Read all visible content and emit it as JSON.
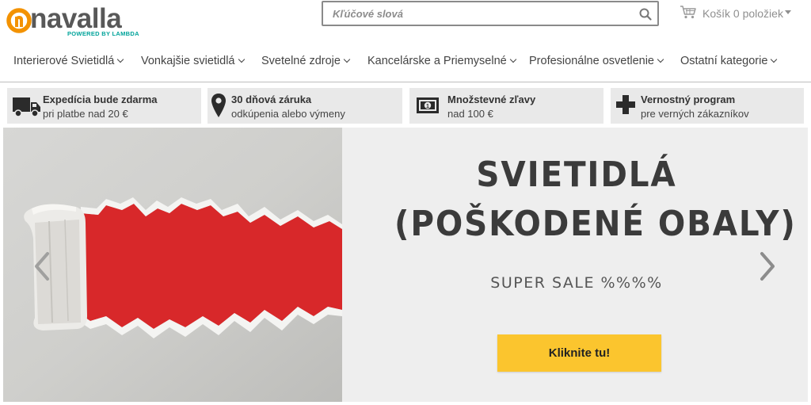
{
  "brand": {
    "name": "navalla",
    "tagline": "POWERED BY LAMBDA",
    "accent": "#f39200",
    "tagline_color": "#00a39a"
  },
  "search": {
    "placeholder": "Kľúčové slová",
    "value": "",
    "icon": "search-icon"
  },
  "cart": {
    "label": "Košík 0 položiek",
    "icon": "shopping-cart-icon"
  },
  "nav": {
    "items": [
      {
        "label": "Interierové Svietidlá"
      },
      {
        "label": "Vonkajšie svietidlá"
      },
      {
        "label": "Svetelné zdroje"
      },
      {
        "label": "Kancelárske a Priemyselné"
      },
      {
        "label": "Profesionálne osvetlenie"
      },
      {
        "label": "Ostatní kategorie"
      }
    ]
  },
  "benefits": [
    {
      "icon": "truck-icon",
      "title": "Expedícia bude zdarma",
      "subtitle": "pri platbe nad 20 €"
    },
    {
      "icon": "map-pin-icon",
      "title": "30 dňová záruka",
      "subtitle": "odkúpenia alebo výmeny"
    },
    {
      "icon": "banknote-icon",
      "title": "Množstevné zľavy",
      "subtitle": "nad 100 €"
    },
    {
      "icon": "plus-icon",
      "title": "Vernostný program",
      "subtitle": "pre verných zákazníkov"
    }
  ],
  "hero": {
    "title_line1": "SVIETIDLÁ",
    "title_line2": "(POŠKODENÉ OBALY)",
    "subtitle": "SUPER SALE %%%%",
    "cta_label": "Kliknite tu!",
    "cta_color": "#fbc52e",
    "image_accent": "#d8282a"
  }
}
